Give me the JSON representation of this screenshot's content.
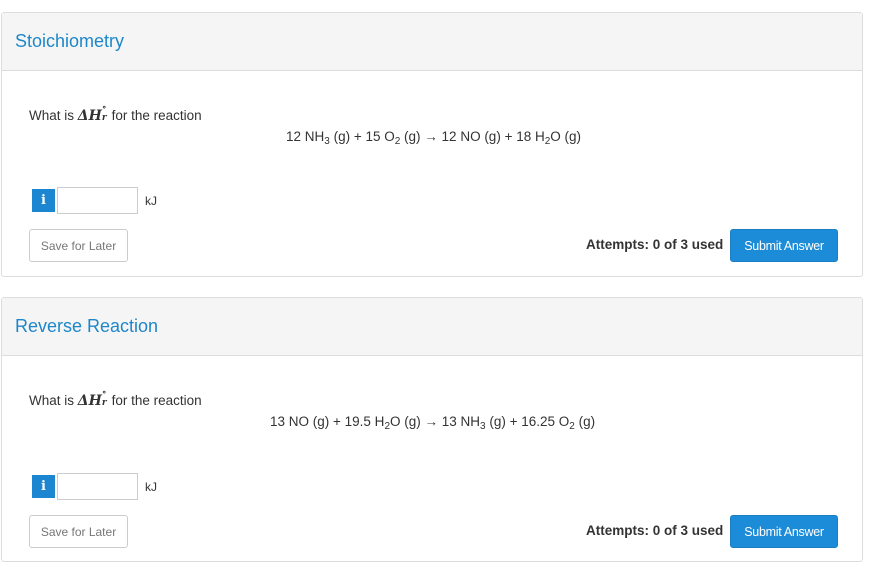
{
  "questions": [
    {
      "title": "Stoichiometry",
      "prompt_prefix": "What is",
      "delta_h": "ΔH",
      "sup": "∘",
      "sub": "r",
      "prompt_suffix": "for the reaction",
      "reaction": {
        "pre1": "12 NH",
        "s1": "3",
        "mid1": " (g) + 15 O",
        "s2": "2",
        "mid2": " (g) → 12 NO (g) + 18 H",
        "s3": "2",
        "post": "O (g)"
      },
      "info_label": "i",
      "answer_value": "",
      "unit": "kJ",
      "save_label": "Save for Later",
      "attempts": "Attempts: 0 of 3 used",
      "submit_label": "Submit Answer"
    },
    {
      "title": "Reverse Reaction",
      "prompt_prefix": "What is",
      "delta_h": "ΔH",
      "sup": "∘",
      "sub": "r",
      "prompt_suffix": "for the reaction",
      "reaction": {
        "pre1": "13 NO (g) + 19.5 H",
        "s1": "2",
        "mid1": "O (g) → 13 NH",
        "s2": "3",
        "mid2": " (g) + 16.25 O",
        "s3": "2",
        "post": " (g)"
      },
      "info_label": "i",
      "answer_value": "",
      "unit": "kJ",
      "save_label": "Save for Later",
      "attempts": "Attempts: 0 of 3 used",
      "submit_label": "Submit Answer"
    }
  ],
  "colors": {
    "accent": "#1c87d0",
    "title": "#1d87c9",
    "heading_bg": "#f5f5f5"
  }
}
